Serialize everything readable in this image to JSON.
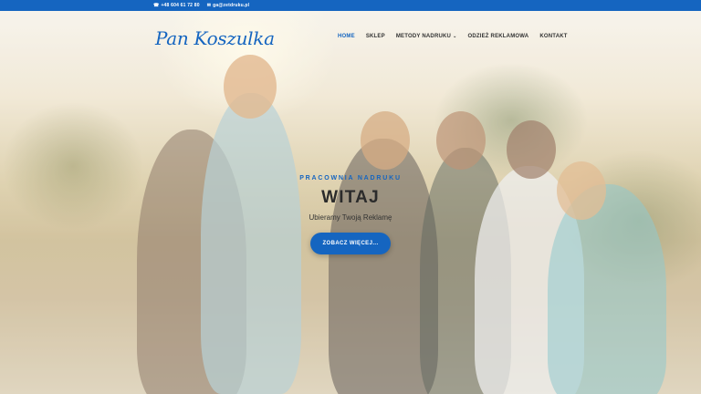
{
  "topbar": {
    "phone": "+48 604 61 72 80",
    "email": "ga@zetdruku.pl",
    "phone_icon": "phone-icon",
    "email_icon": "mail-icon"
  },
  "header": {
    "logo": "Pan Koszulka",
    "nav": [
      {
        "label": "HOME",
        "active": true
      },
      {
        "label": "SKLEP"
      },
      {
        "label": "METODY NADRUKU",
        "has_dropdown": true
      },
      {
        "label": "ODZIEŻ REKLAMOWA"
      },
      {
        "label": "KONTAKT"
      }
    ]
  },
  "hero": {
    "kicker": "PRACOWNIA NADRUKU",
    "title": "WITAJ",
    "subtitle": "Ubieramy Twoją Reklamę",
    "cta": "ZOBACZ WIĘCEJ..."
  },
  "colors": {
    "brand": "#1565c0",
    "text_dark": "#333333"
  }
}
